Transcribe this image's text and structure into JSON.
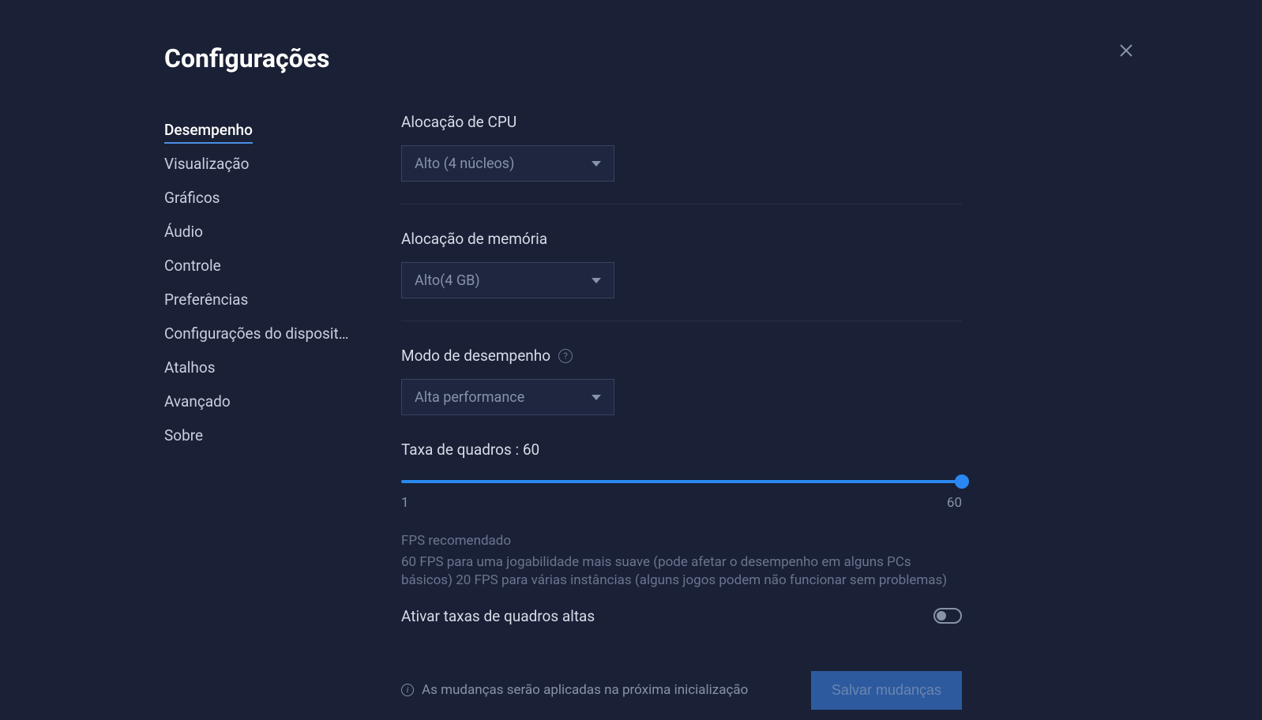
{
  "title": "Configurações",
  "sidebar": {
    "items": [
      {
        "label": "Desempenho",
        "active": true
      },
      {
        "label": "Visualização",
        "active": false
      },
      {
        "label": "Gráficos",
        "active": false
      },
      {
        "label": "Áudio",
        "active": false
      },
      {
        "label": "Controle",
        "active": false
      },
      {
        "label": "Preferências",
        "active": false
      },
      {
        "label": "Configurações do disposit…",
        "active": false
      },
      {
        "label": "Atalhos",
        "active": false
      },
      {
        "label": "Avançado",
        "active": false
      },
      {
        "label": "Sobre",
        "active": false
      }
    ]
  },
  "main": {
    "cpu": {
      "label": "Alocação de CPU",
      "value": "Alto (4 núcleos)"
    },
    "memory": {
      "label": "Alocação de memória",
      "value": "Alto(4 GB)"
    },
    "performance": {
      "label": "Modo de desempenho",
      "value": "Alta performance"
    },
    "framerate": {
      "label": "Taxa de quadros : 60",
      "min": "1",
      "max": "60",
      "value": 60
    },
    "fps_info": {
      "title": "FPS recomendado",
      "description": "60 FPS para uma jogabilidade mais suave (pode afetar o desempenho em alguns PCs básicos) 20 FPS para várias instâncias (alguns jogos podem não funcionar sem problemas)"
    },
    "high_fps_toggle": {
      "label": "Ativar taxas de quadros altas",
      "enabled": false
    }
  },
  "footer": {
    "notice": "As mudanças serão aplicadas na próxima inicialização",
    "save_label": "Salvar mudanças"
  }
}
